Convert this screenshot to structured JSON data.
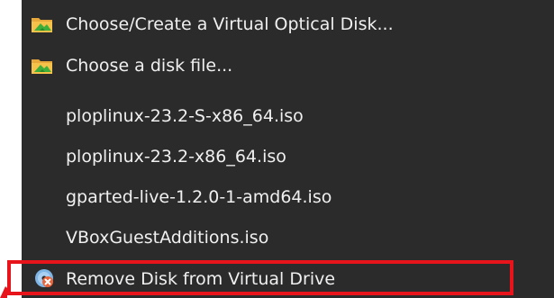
{
  "menu": {
    "items": [
      {
        "label": "Choose/Create a Virtual Optical Disk...",
        "icon": "folder-optical-disk-icon"
      },
      {
        "label": "Choose a disk file...",
        "icon": "folder-optical-disk-icon"
      },
      {
        "label": "ploplinux-23.2-S-x86_64.iso"
      },
      {
        "label": "ploplinux-23.2-x86_64.iso"
      },
      {
        "label": "gparted-live-1.2.0-1-amd64.iso"
      },
      {
        "label": "VBoxGuestAdditions.iso"
      },
      {
        "label": "Remove Disk from Virtual Drive",
        "icon": "remove-disk-icon"
      }
    ]
  },
  "annotation": {
    "highlight_color": "#e8141c",
    "highlighted_item": "Remove Disk from Virtual Drive"
  },
  "colors": {
    "menu_background": "#2b2b2b",
    "menu_text": "#f0f0f0"
  }
}
